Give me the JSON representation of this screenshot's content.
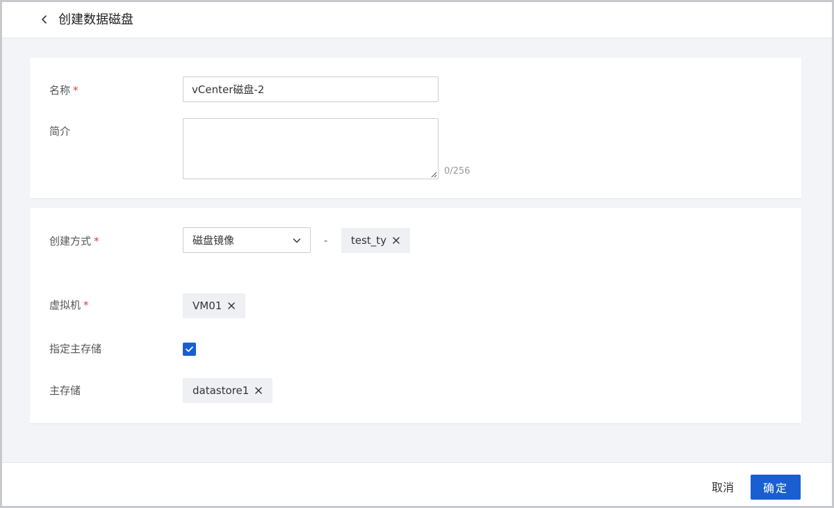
{
  "header": {
    "title": "创建数据磁盘",
    "back_icon": "chevron-left-icon"
  },
  "basic": {
    "name_label": "名称",
    "name_value": "vCenter磁盘-2",
    "description_label": "简介",
    "description_value": "",
    "description_counter": "0/256",
    "required_mark": "*"
  },
  "source": {
    "method_label": "创建方式",
    "method_value": "磁盘镜像",
    "separator": "-",
    "image_tag": "test_ty",
    "vm_label": "虚拟机",
    "vm_tag": "VM01",
    "specify_storage_label": "指定主存储",
    "specify_storage_checked": true,
    "storage_label": "主存储",
    "storage_tag": "datastore1",
    "required_mark": "*"
  },
  "footer": {
    "cancel_label": "取消",
    "confirm_label": "确定"
  },
  "colors": {
    "primary": "#1a5fd0",
    "required": "#e23c3c",
    "tag_bg": "#eef0f3",
    "page_bg": "#f3f4f7"
  }
}
